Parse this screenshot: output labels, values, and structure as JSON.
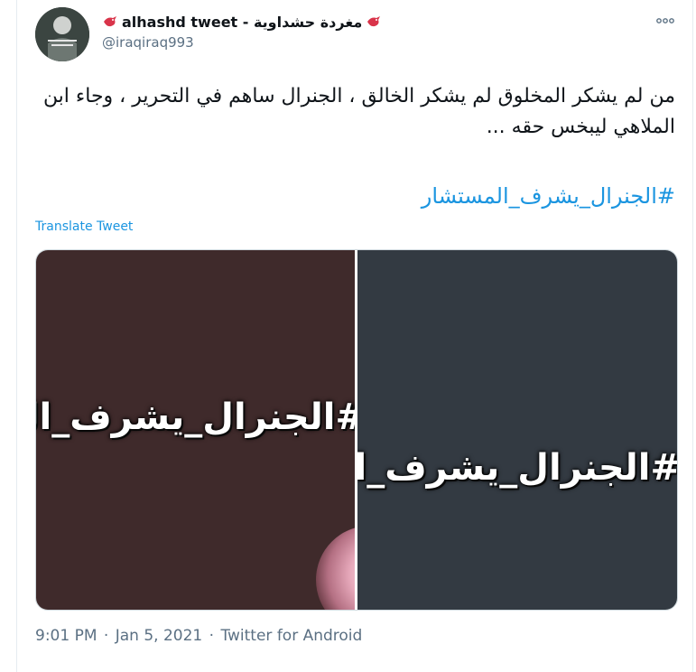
{
  "tweet": {
    "display_name": "alhashd tweet - مغردة حشداوية",
    "handle": "@iraqiraq993",
    "text": "من لم يشكر المخلوق لم يشكر الخالق ، الجنرال ساهم في التحرير ، وجاء ابن الملاهي ليبخس حقه ...",
    "hashtag": "#الجنرال_يشرف_المستشار",
    "translate_label": "Translate Tweet",
    "time": "9:01 PM",
    "date": "Jan 5, 2021",
    "source": "Twitter for Android",
    "separator": "·"
  },
  "media": {
    "left_image_text": "#الجنرال_يشرف_المستشار",
    "right_image_text": "#الجنرال_يشرف_المستشار"
  },
  "icons": {
    "emoji_before_name": "bird-emoji",
    "emoji_after_name": "bird-emoji",
    "more": "more-icon"
  },
  "colors": {
    "link": "#1b95e0",
    "secondary": "#5b7083",
    "left_panel": "#3f2a2b",
    "right_panel": "#333a42"
  }
}
